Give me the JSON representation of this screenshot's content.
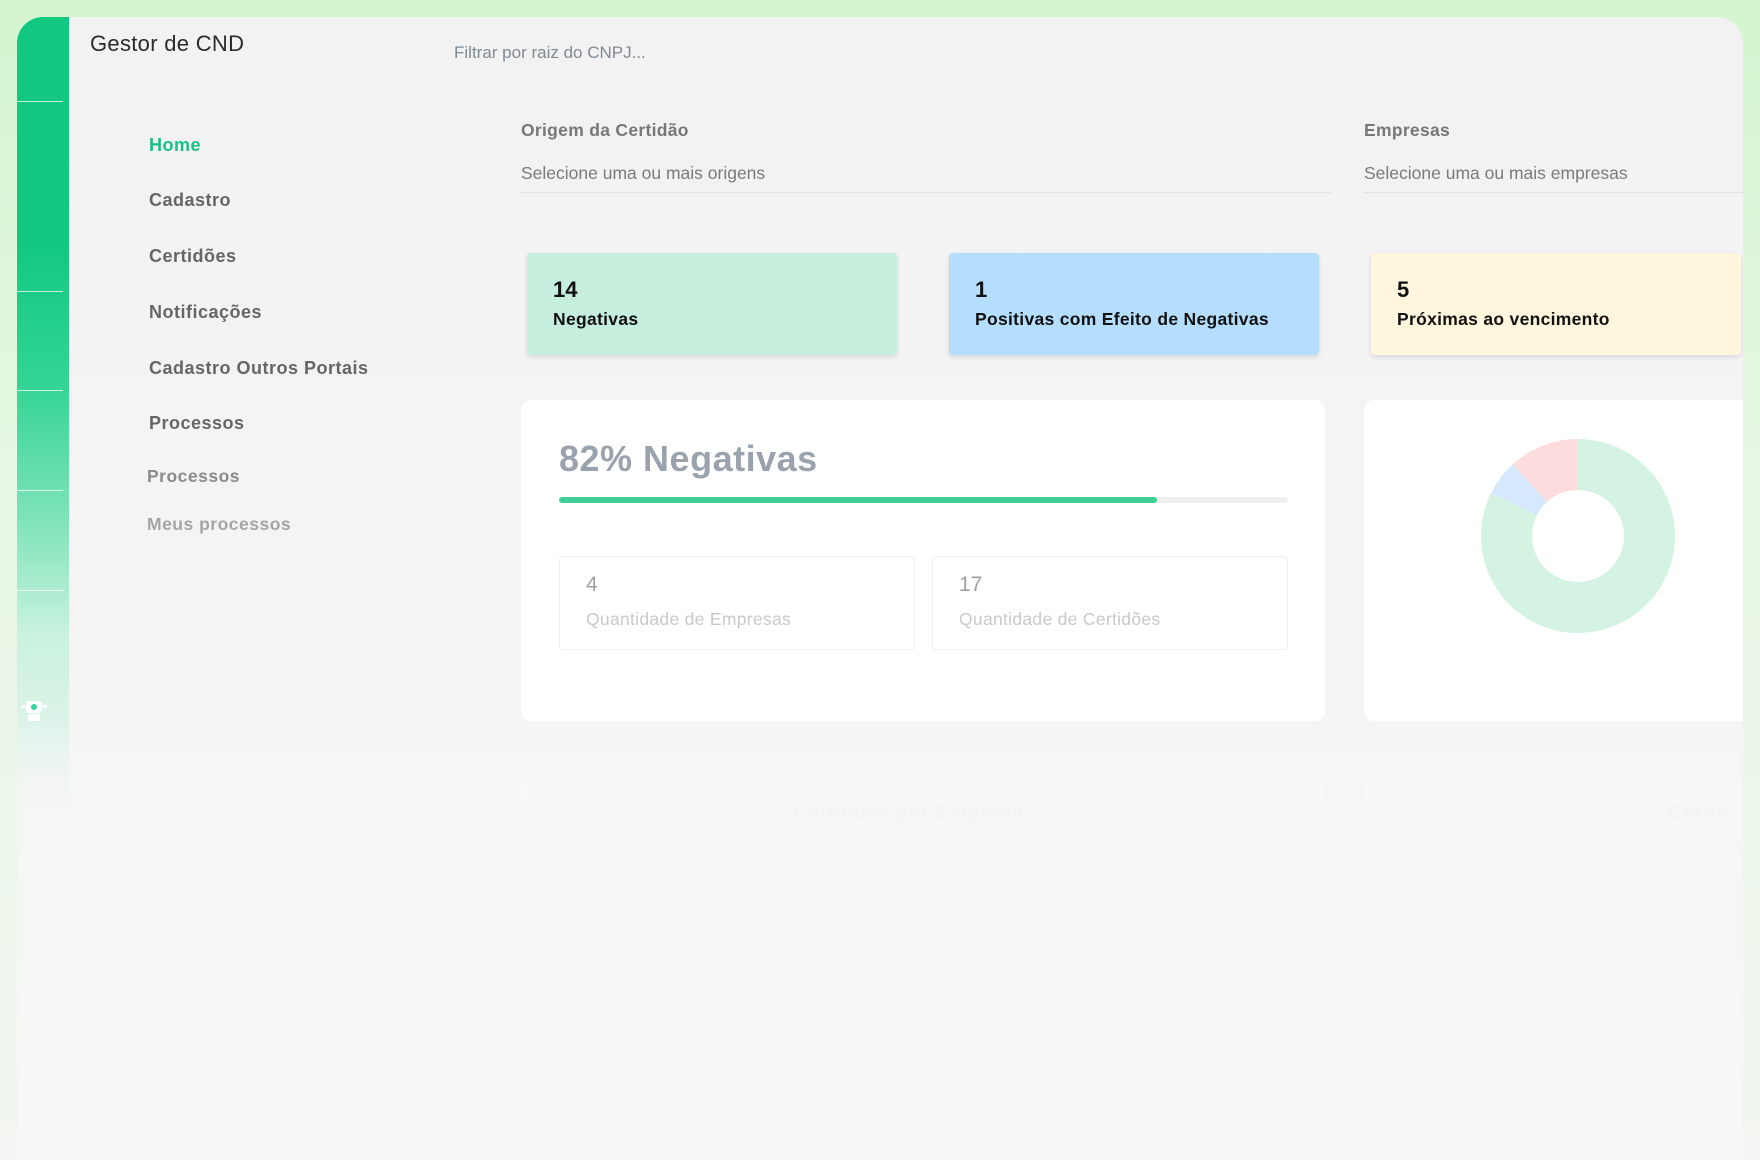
{
  "app": {
    "title": "Gestor de CND"
  },
  "search": {
    "placeholder": "Filtrar por raiz do CNPJ..."
  },
  "nav": {
    "items": [
      {
        "label": "Home",
        "active": true
      },
      {
        "label": "Cadastro"
      },
      {
        "label": "Certidões"
      },
      {
        "label": "Notificações"
      },
      {
        "label": "Cadastro Outros Portais"
      },
      {
        "label": "Processos"
      }
    ],
    "sub_items": [
      {
        "label": "Processos"
      },
      {
        "label": "Meus processos"
      }
    ]
  },
  "filters": {
    "origem": {
      "label": "Origem da Certidão",
      "placeholder": "Selecione uma ou mais origens"
    },
    "empresas": {
      "label": "Empresas",
      "placeholder": "Selecione uma ou mais empresas"
    }
  },
  "stats": [
    {
      "value": "14",
      "label": "Negativas",
      "color": "#c6eedc"
    },
    {
      "value": "1",
      "label": "Positivas com Efeito de Negativas",
      "color": "#b5defe"
    },
    {
      "value": "5",
      "label": "Próximas ao vencimento",
      "color": "#fff6dd"
    }
  ],
  "summary": {
    "title": "82% Negativas",
    "progress_percent": 82,
    "companies": {
      "value": "4",
      "label": "Quantidade de Empresas"
    },
    "certificates": {
      "value": "17",
      "label": "Quantidade de Certidões"
    }
  },
  "donut": {
    "segments": [
      {
        "value": 14,
        "color": "#d5f3e3"
      },
      {
        "value": 1,
        "color": "#d6e8fb"
      },
      {
        "value": 2,
        "color": "#fcdcdc"
      }
    ]
  },
  "lower_cards": {
    "left_title": "Certidões por Empresa",
    "right_title": "Certid"
  },
  "colors": {
    "accent": "#19c184",
    "rail": "#12c881"
  }
}
